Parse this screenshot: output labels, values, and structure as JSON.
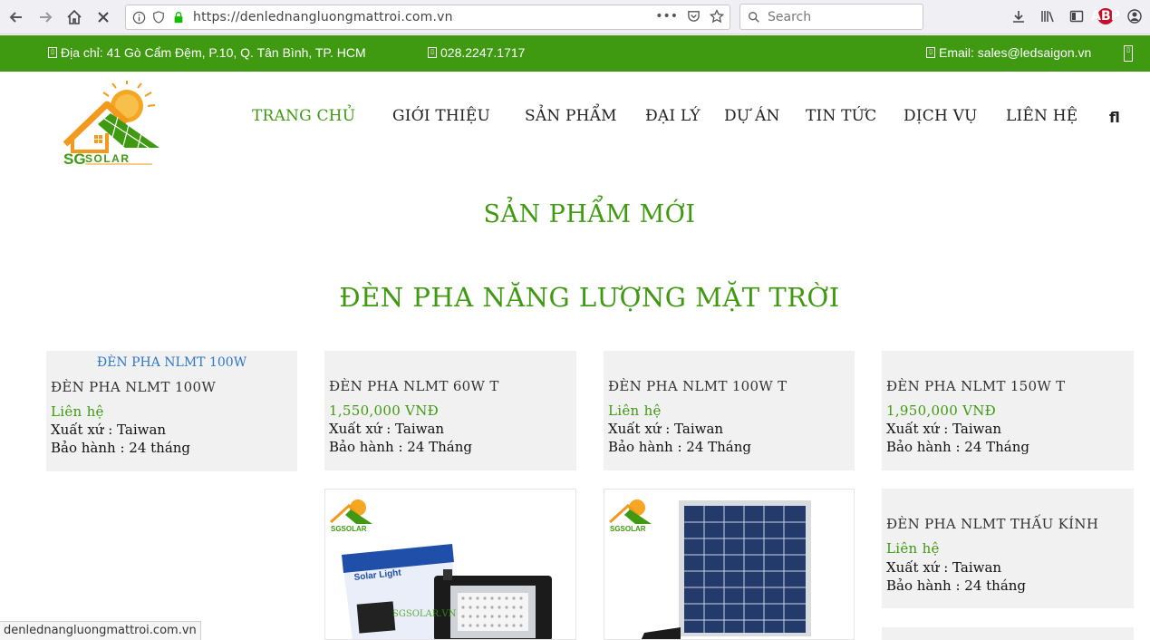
{
  "browser": {
    "url": "https://denlednangluongmattroi.com.vn",
    "search_placeholder": "Search",
    "status_url": "denlednangluongmattroi.com.vn"
  },
  "topbar": {
    "address": "Địa chỉ: 41 Gò Cẩm Đệm, P.10, Q. Tân Bình, TP. HCM",
    "phone": "028.2247.1717",
    "email": "Email: sales@ledsaigon.vn"
  },
  "logo": {
    "text_sg": "SG",
    "text_solar": "SOLAR"
  },
  "nav": {
    "home": "TRANG CHỦ",
    "about": "GIỚI THIỆU",
    "products": "SẢN PHẨM",
    "dealers": "ĐẠI LÝ",
    "projects": "DỰ ÁN",
    "news": "TIN TỨC",
    "services": "DỊCH VỤ",
    "contact": "LIÊN HỆ",
    "search_glyph": "fl"
  },
  "headings": {
    "new_products": "SẢN PHẨM MỚI",
    "category": "ĐÈN PHA NĂNG LƯỢNG MẶT TRỜI"
  },
  "products": [
    {
      "link": "ĐÈN PHA NLMT 100W",
      "name": "ĐÈN PHA NLMT 100W",
      "price": "Liên hệ",
      "origin": "Xuất xứ : Taiwan",
      "warranty": "Bảo hành : 24 tháng"
    },
    {
      "name": "ĐÈN PHA NLMT 60W T",
      "price": "1,550,000 VNĐ",
      "origin": "Xuất xứ : Taiwan",
      "warranty": "Bảo hành : 24 Tháng"
    },
    {
      "name": "ĐÈN PHA NLMT 100W T",
      "price": "Liên hệ",
      "origin": "Xuất xứ : Taiwan",
      "warranty": "Bảo hành : 24 Tháng"
    },
    {
      "name": "ĐÈN PHA NLMT 150W T",
      "price": "1,950,000 VNĐ",
      "origin": "Xuất xứ : Taiwan",
      "warranty": "Bảo hành : 24 Tháng"
    },
    {
      "name": "ĐÈN PHA NLMT THẤU KÍNH",
      "price": "Liên hệ",
      "origin": "Xuất xứ : Taiwan",
      "warranty": "Bảo hành : 24 tháng"
    }
  ],
  "product_images": {
    "box_label": "Solar Light",
    "watermark": "SGSOLAR.VN"
  },
  "colors": {
    "brand_green": "#3f9a12",
    "accent_orange": "#f39a1e",
    "link_blue": "#2e78c7"
  }
}
